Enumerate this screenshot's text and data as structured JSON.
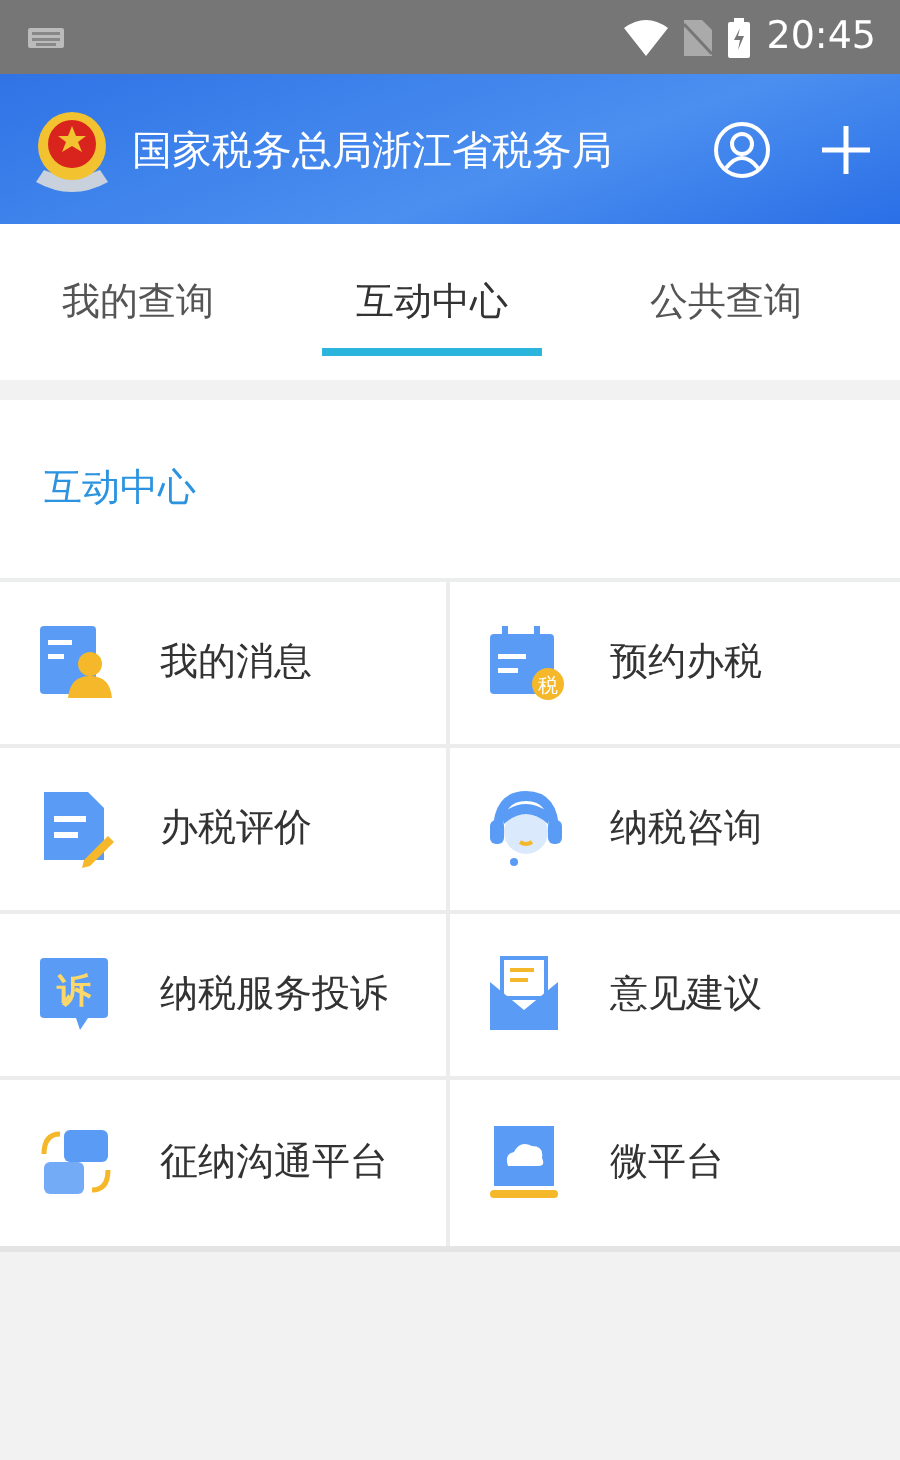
{
  "status_bar": {
    "time": "20:45"
  },
  "header": {
    "title": "国家税务总局浙江省税务局"
  },
  "tabs": [
    {
      "label": "我的查询",
      "selected": false
    },
    {
      "label": "互动中心",
      "selected": true
    },
    {
      "label": "公共查询",
      "selected": false
    }
  ],
  "section": {
    "title": "互动中心"
  },
  "items": [
    {
      "kind": "message",
      "label": "我的消息"
    },
    {
      "kind": "calendar",
      "label": "预约办税",
      "icon_text": "税"
    },
    {
      "kind": "document",
      "label": "办税评价"
    },
    {
      "kind": "headset",
      "label": "纳税咨询"
    },
    {
      "kind": "complaint",
      "label": "纳税服务投诉",
      "icon_text": "诉"
    },
    {
      "kind": "mail",
      "label": "意见建议"
    },
    {
      "kind": "exchange",
      "label": "征纳沟通平台"
    },
    {
      "kind": "cloud",
      "label": "微平台"
    }
  ]
}
